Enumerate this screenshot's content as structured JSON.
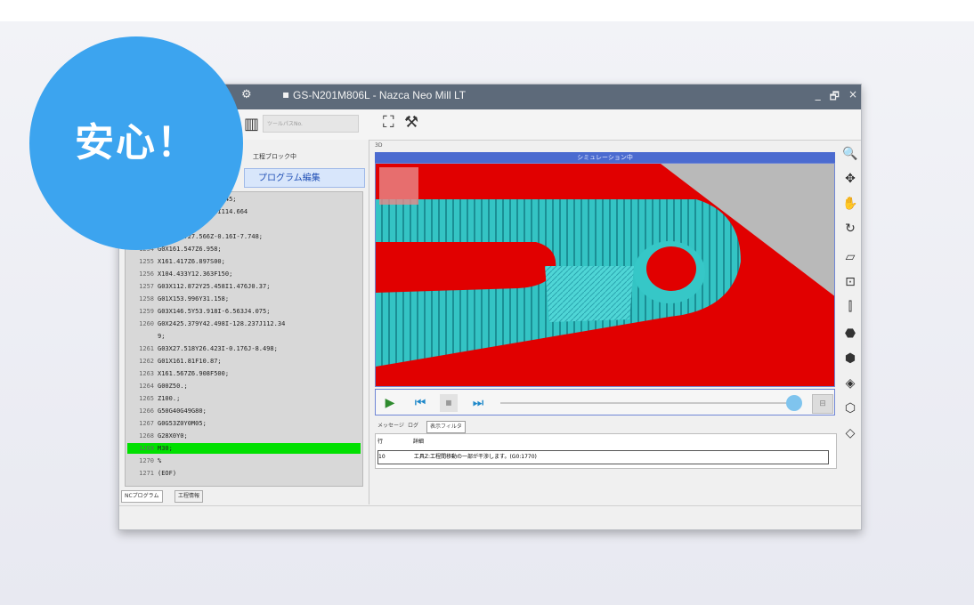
{
  "badge": {
    "text": "安心！"
  },
  "window": {
    "title": "GS-N201M806L - Nazca Neo Mill LT",
    "controls": {
      "minimize": "_",
      "restore": "🗗",
      "close": "×"
    }
  },
  "toolbar": {
    "field_placeholder": "ツールパスNo."
  },
  "left_pane": {
    "header": "工程ブロック中",
    "program_button": "プログラム編集",
    "code_lines": [
      {
        "num": "",
        "text": "X61.399Z-6.348I4.445;"
      },
      {
        "num": "",
        "text": "Y42.748I-118.878I114.664"
      },
      {
        "num": "",
        "text": ""
      },
      {
        "num": "",
        "text": "X11.658Y27.566Z-0.16I-7.748;"
      },
      {
        "num": "1254",
        "text": "G0X161.547Z6.958;"
      },
      {
        "num": "1255",
        "text": "X161.417Z6.897S00;"
      },
      {
        "num": "1256",
        "text": "X104.433Y12.363F150;"
      },
      {
        "num": "1257",
        "text": "G03X112.872Y25.458I1.476J0.37;"
      },
      {
        "num": "1258",
        "text": "G01X153.996Y31.158;"
      },
      {
        "num": "1259",
        "text": "G03X146.5Y53.918I-6.563J4.075;"
      },
      {
        "num": "1260",
        "text": "G0X2425.379Y42.498I-128.237J112.34"
      },
      {
        "num": "",
        "text": "9;"
      },
      {
        "num": "1261",
        "text": "G03X27.518Y26.423I-0.176J-8.498;"
      },
      {
        "num": "1262",
        "text": "G01X161.81F10.87;"
      },
      {
        "num": "1263",
        "text": "X161.567Z6.908F500;"
      },
      {
        "num": "1264",
        "text": "G00Z50.;"
      },
      {
        "num": "1265",
        "text": "Z100.;"
      },
      {
        "num": "1266",
        "text": "G50G40G49G80;"
      },
      {
        "num": "1267",
        "text": "G0G53Z0Y0M05;"
      },
      {
        "num": "1268",
        "text": "G28X0Y0;"
      },
      {
        "num": "1269",
        "text": "M30;"
      },
      {
        "num": "1270",
        "text": "%"
      },
      {
        "num": "1271",
        "text": "(EOF)"
      }
    ],
    "tabs": [
      "NCプログラム",
      "工程情報"
    ]
  },
  "right_pane": {
    "label": "3D",
    "sim_status": "シミュレーション中",
    "message_tabs": [
      "メッセージ",
      "ログ",
      "表示フィルタ"
    ],
    "message_header": {
      "col1": "行",
      "col2": "詳細"
    },
    "messages": [
      {
        "line": "10",
        "text": "工具Z:工程間移動の一部が干渉します。(G0:1770)"
      }
    ]
  },
  "colors": {
    "badge": "#3ca4ef",
    "titlebar": "#5d6a7a",
    "stock": "#e10000",
    "toolpath": "#36c7c7",
    "highlight": "#00e000",
    "accent": "#4b6bd0"
  }
}
